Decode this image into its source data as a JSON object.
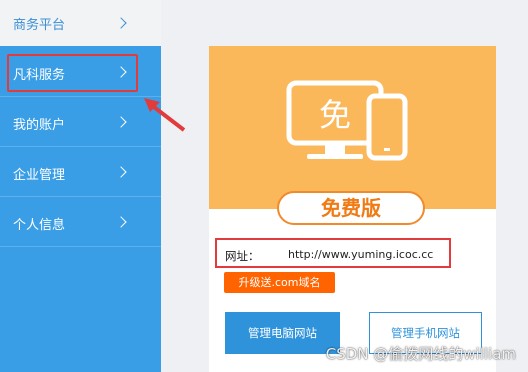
{
  "sidebar": {
    "top_item": {
      "label": "商务平台",
      "icon": "chevron-right-icon"
    },
    "items": [
      {
        "label": "凡科服务",
        "icon": "chevron-right-icon"
      },
      {
        "label": "我的账户",
        "icon": "chevron-right-icon"
      },
      {
        "label": "企业管理",
        "icon": "chevron-right-icon"
      },
      {
        "label": "个人信息",
        "icon": "chevron-right-icon"
      }
    ]
  },
  "card": {
    "illustration_text": "免",
    "plan_label": "免费版",
    "url_label": "网址：",
    "url_value": "http://www.yuming.icoc.cc",
    "promo_tag": "升级送.com域名",
    "manage_pc_label": "管理电脑网站",
    "manage_mobile_label": "管理手机网站"
  },
  "annotation": {
    "highlight_color": "#e23b3b"
  },
  "colors": {
    "sidebar_blue": "#3a9ee6",
    "card_orange": "#fbb85a",
    "accent_orange": "#f07a13",
    "tag_orange": "#ff6400",
    "button_blue": "#2f93dc"
  },
  "watermark": "CSDN @偷拨网线的william"
}
